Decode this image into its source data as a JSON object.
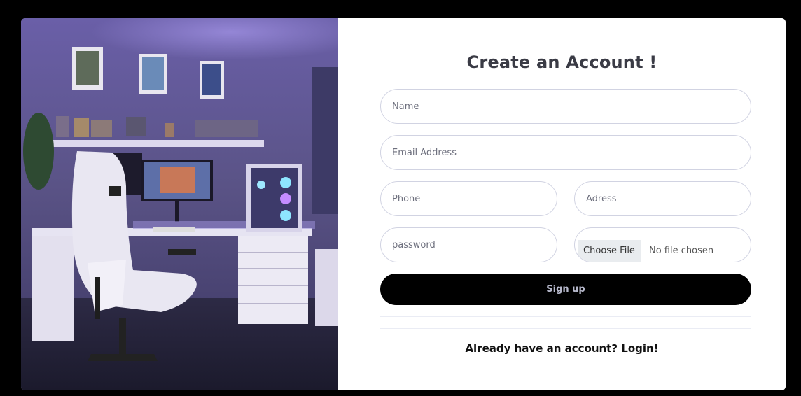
{
  "form": {
    "title": "Create an Account !",
    "name_placeholder": "Name",
    "email_placeholder": "Email Address",
    "phone_placeholder": "Phone",
    "address_placeholder": "Adress",
    "password_placeholder": "password",
    "file_button_label": "Choose File",
    "file_status": "No file chosen",
    "signup_label": "Sign up",
    "login_link": "Already have an account? Login!"
  }
}
